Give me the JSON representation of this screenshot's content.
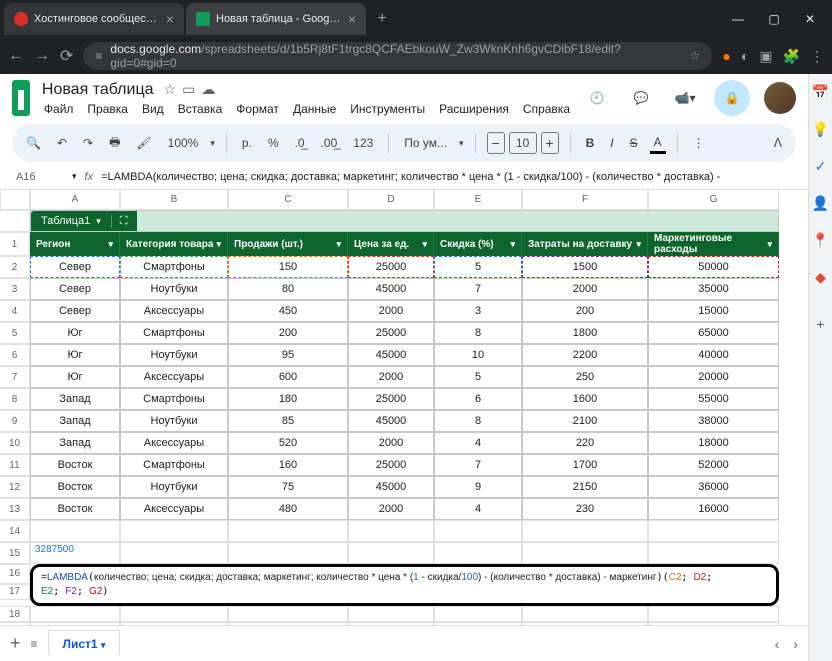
{
  "browser": {
    "tabs": [
      {
        "title": "Хостинговое сообщество «Tir"
      },
      {
        "title": "Новая таблица - Google Табли"
      }
    ],
    "url_domain": "docs.google.com",
    "url_path": "/spreadsheets/d/1b5Rj8tF1trgc8QCFAEbkouW_Zw3WknKnh6gvCDibF18/edit?gid=0#gid=0"
  },
  "doc": {
    "title": "Новая таблица",
    "menus": [
      "Файл",
      "Правка",
      "Вид",
      "Вставка",
      "Формат",
      "Данные",
      "Инструменты",
      "Расширения",
      "Справка"
    ],
    "zoom": "100%",
    "currency": "р.",
    "percent": "%",
    "decimals_dec": ".0",
    "decimals_inc": ".00",
    "numfmt": "123",
    "font": "По ум...",
    "fontsize": "10",
    "bold": "B",
    "italic": "I",
    "strike": "S",
    "underline": "A"
  },
  "cell_ref": "A16",
  "formula_bar": "=LAMBDA(количество; цена; скидка; доставка; маркетинг; количество * цена * (1 - скидка/100) - (количество * доставка) -",
  "table": {
    "name": "Таблица1",
    "col_letters": [
      "A",
      "B",
      "C",
      "D",
      "E",
      "F",
      "G"
    ],
    "headers": [
      "Регион",
      "Категория товара",
      "Продажи (шт.)",
      "Цена за ед.",
      "Скидка (%)",
      "Затраты на доставку",
      "Маркетинговые расходы"
    ],
    "rows": [
      [
        "Север",
        "Смартфоны",
        "150",
        "25000",
        "5",
        "1500",
        "50000"
      ],
      [
        "Север",
        "Ноутбуки",
        "80",
        "45000",
        "7",
        "2000",
        "35000"
      ],
      [
        "Север",
        "Аксессуары",
        "450",
        "2000",
        "3",
        "200",
        "15000"
      ],
      [
        "Юг",
        "Смартфоны",
        "200",
        "25000",
        "8",
        "1800",
        "65000"
      ],
      [
        "Юг",
        "Ноутбуки",
        "95",
        "45000",
        "10",
        "2200",
        "40000"
      ],
      [
        "Юг",
        "Аксессуары",
        "600",
        "2000",
        "5",
        "250",
        "20000"
      ],
      [
        "Запад",
        "Смартфоны",
        "180",
        "25000",
        "6",
        "1600",
        "55000"
      ],
      [
        "Запад",
        "Ноутбуки",
        "85",
        "45000",
        "8",
        "2100",
        "38000"
      ],
      [
        "Запад",
        "Аксессуары",
        "520",
        "2000",
        "4",
        "220",
        "18000"
      ],
      [
        "Восток",
        "Смартфоны",
        "160",
        "25000",
        "7",
        "1700",
        "52000"
      ],
      [
        "Восток",
        "Ноутбуки",
        "75",
        "45000",
        "9",
        "2150",
        "36000"
      ],
      [
        "Восток",
        "Аксессуары",
        "480",
        "2000",
        "4",
        "230",
        "16000"
      ]
    ],
    "r15_value": "3287500",
    "formula_cell": "=LAMBDA(количество; цена; скидка; доставка; маркетинг; количество * цена * (1 - скидка/100) - (количество * доставка) - маркетинг)(C2; D2; E2; F2; G2)",
    "sheet_tab": "Лист1"
  }
}
